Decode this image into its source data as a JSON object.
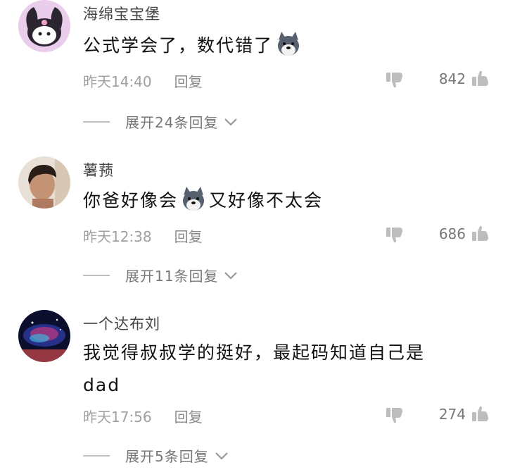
{
  "comments": [
    {
      "username": "海绵宝宝堡",
      "text_before": "公式学会了，数代错了",
      "text_after": "",
      "text_line2": "",
      "time": "昨天14:40",
      "reply_label": "回复",
      "likes": "842",
      "expand_label": "展开24条回复"
    },
    {
      "username": "薯蓣",
      "text_before": "你爸好像会",
      "text_after": "又好像不太会",
      "text_line2": "",
      "time": "昨天12:38",
      "reply_label": "回复",
      "likes": "686",
      "expand_label": "展开11条回复"
    },
    {
      "username": "一个达布刘",
      "text_before": "我觉得叔叔学的挺好，最起码知道自己是",
      "text_after": "",
      "text_line2": "dad",
      "time": "昨天17:56",
      "reply_label": "回复",
      "likes": "274",
      "expand_label": "展开5条回复"
    }
  ],
  "icons": {
    "like": "thumbs-up-icon",
    "dislike": "thumbs-down-icon",
    "expand": "chevron-down-icon",
    "emoji": "doge-emoji-icon"
  },
  "colors": {
    "icon_gray": "#bdbdbd",
    "meta_gray": "#a0a0a0"
  }
}
